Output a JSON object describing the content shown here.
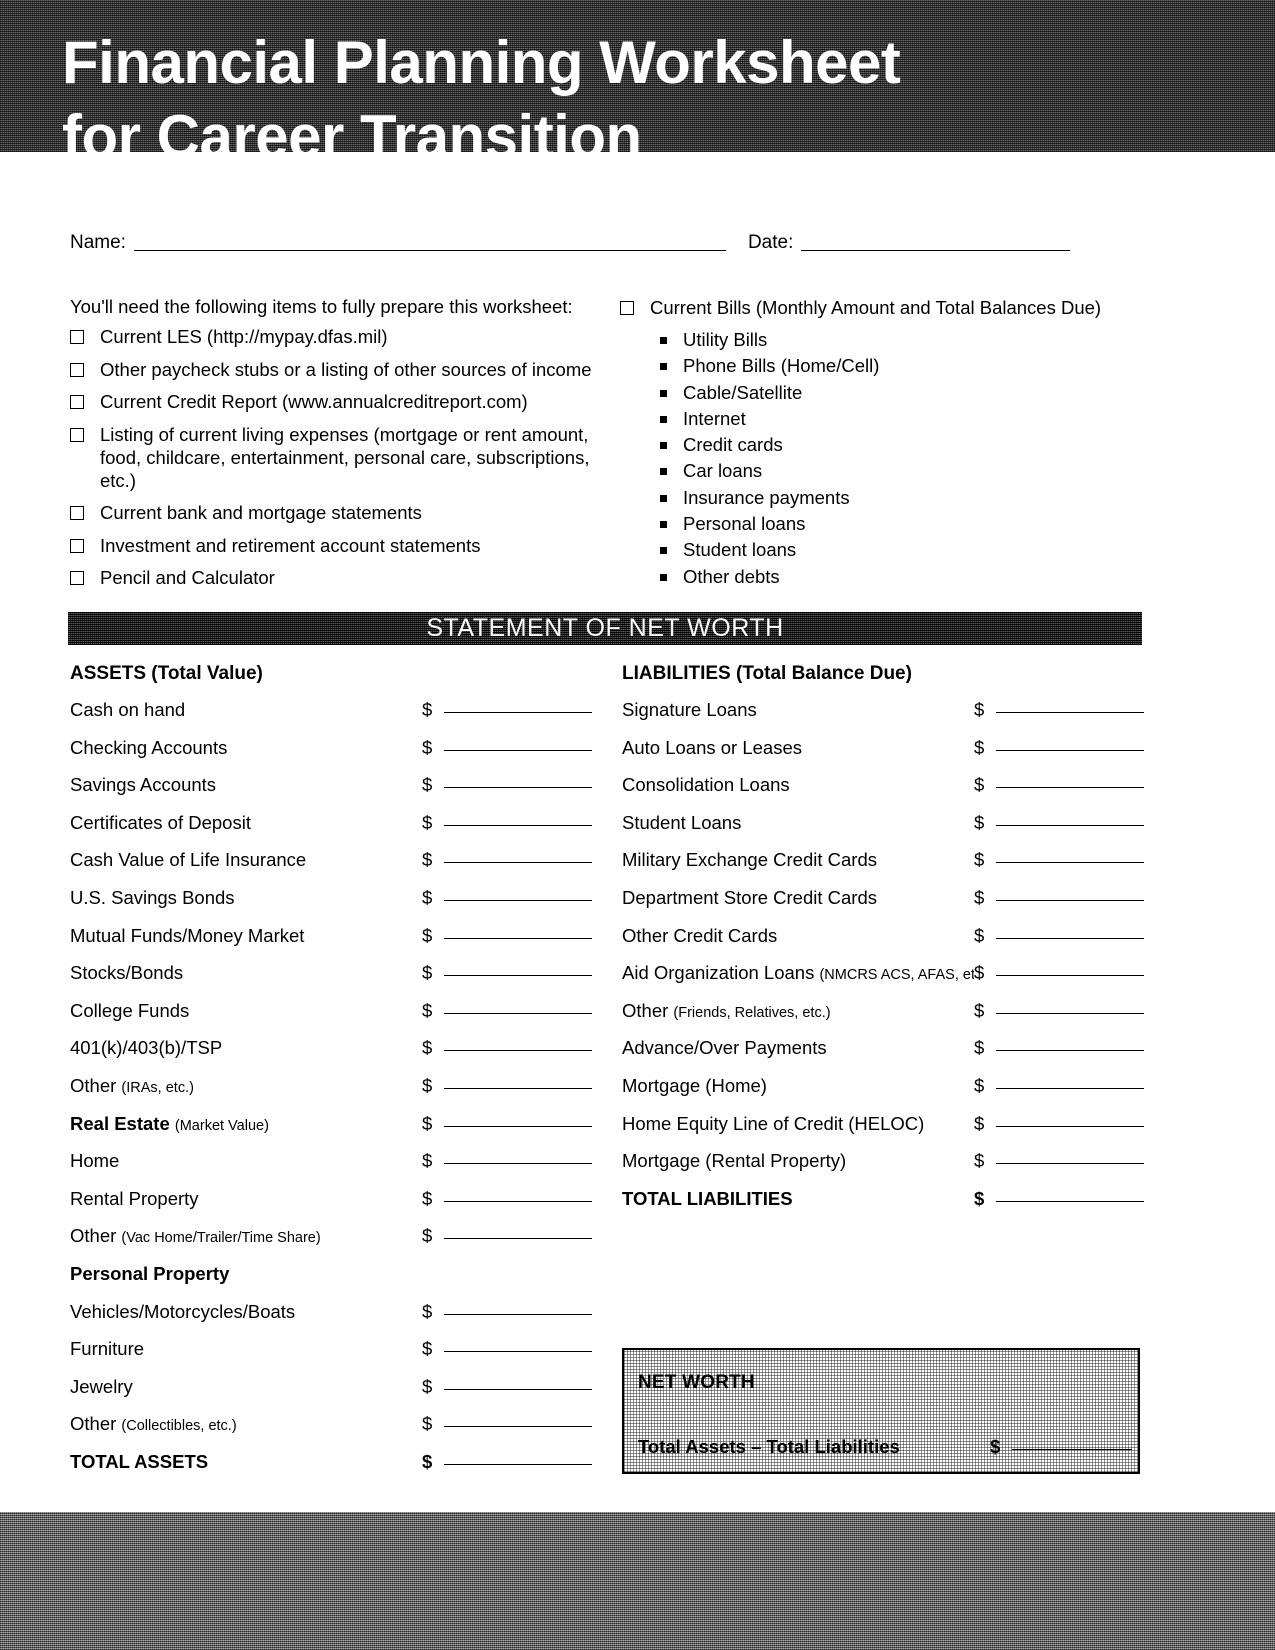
{
  "header": {
    "title_line1": "Financial Planning Worksheet",
    "title_line2": "for Career Transition"
  },
  "identity": {
    "name_label": "Name:",
    "date_label": "Date:"
  },
  "prep": {
    "intro": "You'll need the following items to fully prepare this worksheet:",
    "items": [
      "Current LES (http://mypay.dfas.mil)",
      "Other paycheck stubs or a listing of other sources of income",
      "Current Credit Report (www.annualcreditreport.com)",
      "Listing of current living expenses (mortgage or rent amount, food, childcare, entertainment, personal care, subscriptions, etc.)",
      "Current bank and mortgage statements",
      "Investment and retirement account statements",
      "Pencil and Calculator"
    ]
  },
  "bills": {
    "heading": "Current Bills (Monthly Amount and Total Balances Due)",
    "items": [
      "Utility Bills",
      "Phone Bills (Home/Cell)",
      "Cable/Satellite",
      "Internet",
      "Credit cards",
      "Car loans",
      "Insurance payments",
      "Personal loans",
      "Student loans",
      "Other debts"
    ]
  },
  "section": {
    "banner": "STATEMENT OF NET WORTH"
  },
  "assets": {
    "heading": "ASSETS  (Total Value)",
    "rows": [
      {
        "label": "Cash on hand",
        "note": "",
        "style": "normal",
        "field": true
      },
      {
        "label": "Checking Accounts",
        "note": "",
        "style": "normal",
        "field": true
      },
      {
        "label": "Savings Accounts",
        "note": "",
        "style": "normal",
        "field": true
      },
      {
        "label": "Certificates of Deposit",
        "note": "",
        "style": "normal",
        "field": true
      },
      {
        "label": "Cash Value of Life Insurance",
        "note": "",
        "style": "normal",
        "field": true
      },
      {
        "label": "U.S. Savings Bonds",
        "note": "",
        "style": "normal",
        "field": true
      },
      {
        "label": "Mutual Funds/Money Market",
        "note": "",
        "style": "normal",
        "field": true
      },
      {
        "label": "Stocks/Bonds",
        "note": "",
        "style": "normal",
        "field": true
      },
      {
        "label": "College Funds",
        "note": "",
        "style": "normal",
        "field": true
      },
      {
        "label": "401(k)/403(b)/TSP",
        "note": "",
        "style": "normal",
        "field": true
      },
      {
        "label": "Other ",
        "note": "(IRAs, etc.)",
        "style": "normal",
        "field": true
      },
      {
        "label": "Real Estate ",
        "note": "(Market Value)",
        "style": "bold-lead",
        "field": true
      },
      {
        "label": "Home",
        "note": "",
        "style": "normal",
        "field": true
      },
      {
        "label": "Rental Property",
        "note": "",
        "style": "normal",
        "field": true
      },
      {
        "label": "Other ",
        "note": "(Vac Home/Trailer/Time Share)",
        "style": "normal",
        "field": true
      },
      {
        "label": "Personal Property",
        "note": "",
        "style": "bold",
        "field": false
      },
      {
        "label": "Vehicles/Motorcycles/Boats",
        "note": "",
        "style": "normal",
        "field": true
      },
      {
        "label": "Furniture",
        "note": "",
        "style": "normal",
        "field": true
      },
      {
        "label": "Jewelry",
        "note": "",
        "style": "normal",
        "field": true
      },
      {
        "label": "Other ",
        "note": "(Collectibles, etc.)",
        "style": "normal",
        "field": true
      },
      {
        "label": "TOTAL ASSETS",
        "note": "",
        "style": "bold",
        "field": true
      }
    ]
  },
  "liabilities": {
    "heading": "LIABILITIES (Total Balance Due)",
    "rows": [
      {
        "label": "Signature Loans",
        "note": "",
        "style": "normal",
        "field": true
      },
      {
        "label": "Auto Loans or Leases",
        "note": "",
        "style": "normal",
        "field": true
      },
      {
        "label": "Consolidation Loans",
        "note": "",
        "style": "normal",
        "field": true
      },
      {
        "label": "Student Loans",
        "note": "",
        "style": "normal",
        "field": true
      },
      {
        "label": "Military Exchange Credit Cards",
        "note": "",
        "style": "normal",
        "field": true
      },
      {
        "label": "Department Store Credit Cards",
        "note": "",
        "style": "normal",
        "field": true
      },
      {
        "label": "Other Credit Cards",
        "note": "",
        "style": "normal",
        "field": true
      },
      {
        "label": "Aid Organization Loans ",
        "note": "(NMCRS ACS, AFAS, etc.)",
        "style": "normal",
        "field": true
      },
      {
        "label": "Other ",
        "note": "(Friends, Relatives, etc.)",
        "style": "normal",
        "field": true
      },
      {
        "label": "Advance/Over Payments",
        "note": "",
        "style": "normal",
        "field": true
      },
      {
        "label": "Mortgage (Home)",
        "note": "",
        "style": "normal",
        "field": true
      },
      {
        "label": "Home Equity Line of Credit (HELOC)",
        "note": "",
        "style": "normal",
        "field": true
      },
      {
        "label": "Mortgage (Rental Property)",
        "note": "",
        "style": "normal",
        "field": true
      },
      {
        "label": "TOTAL LIABILITIES",
        "note": "",
        "style": "bold",
        "field": true
      }
    ]
  },
  "net_worth": {
    "title": "NET WORTH",
    "formula": "Total Assets – Total Liabilities"
  },
  "symbols": {
    "dollar": "$"
  },
  "colors": {
    "header_band": "#4a4a4a",
    "banner_band": "#1c1c1c",
    "footer_band": "#7d7d7d",
    "ink": "#000000",
    "paper": "#ffffff"
  }
}
